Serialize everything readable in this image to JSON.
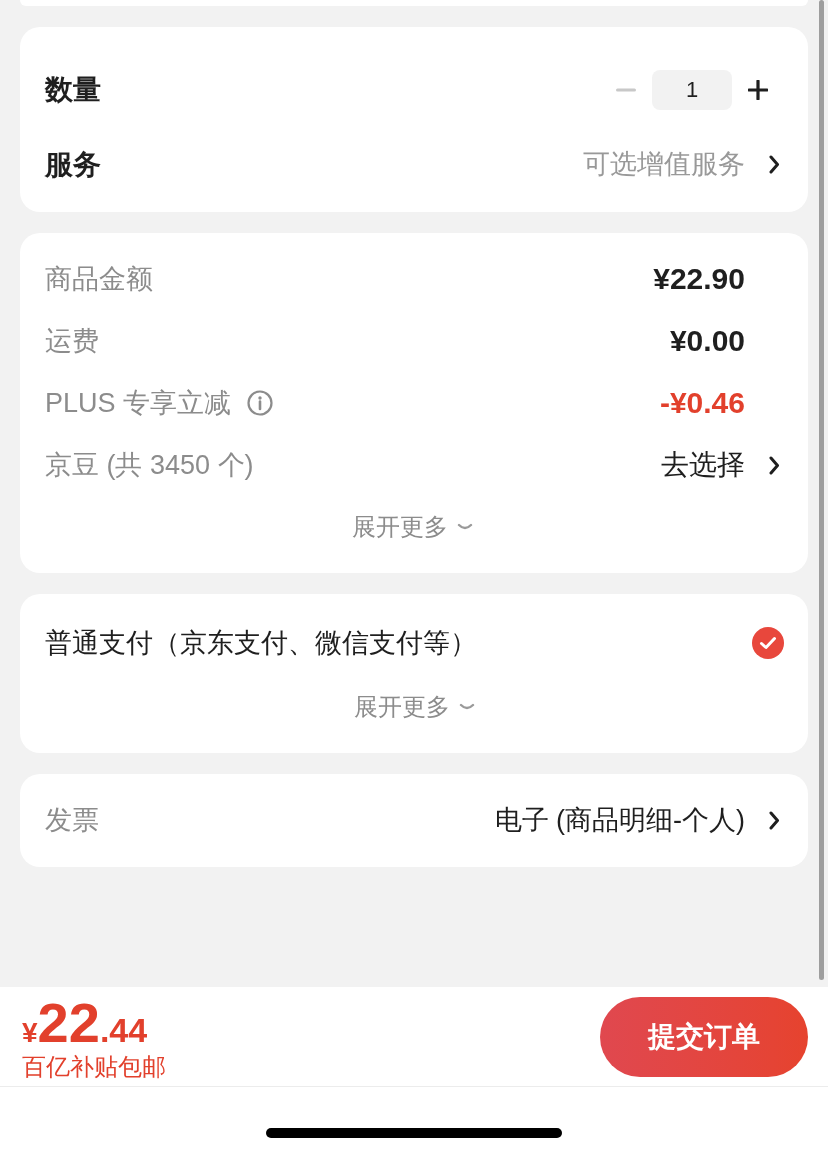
{
  "quantity": {
    "label": "数量",
    "value": "1",
    "decrease_disabled": true
  },
  "service": {
    "label": "服务",
    "value": "可选增值服务"
  },
  "price_summary": {
    "rows": [
      {
        "label": "商品金额",
        "value": "¥22.90",
        "kind": "amount",
        "info": false
      },
      {
        "label": "运费",
        "value": "¥0.00",
        "kind": "amount",
        "info": false
      },
      {
        "label": "PLUS 专享立减",
        "value": "-¥0.46",
        "kind": "discount",
        "info": true
      },
      {
        "label": "京豆 (共 3450 个)",
        "value": "去选择",
        "kind": "select",
        "info": false
      }
    ],
    "expand": "展开更多"
  },
  "payment": {
    "options": [
      {
        "label": "普通支付（京东支付、微信支付等）",
        "selected": true
      }
    ],
    "expand": "展开更多"
  },
  "invoice": {
    "label": "发票",
    "value": "电子 (商品明细-个人)"
  },
  "footer": {
    "price": {
      "currency": "¥",
      "integer": "22",
      "decimal": ".44"
    },
    "note": "百亿补贴包邮",
    "submit": "提交订单"
  }
}
